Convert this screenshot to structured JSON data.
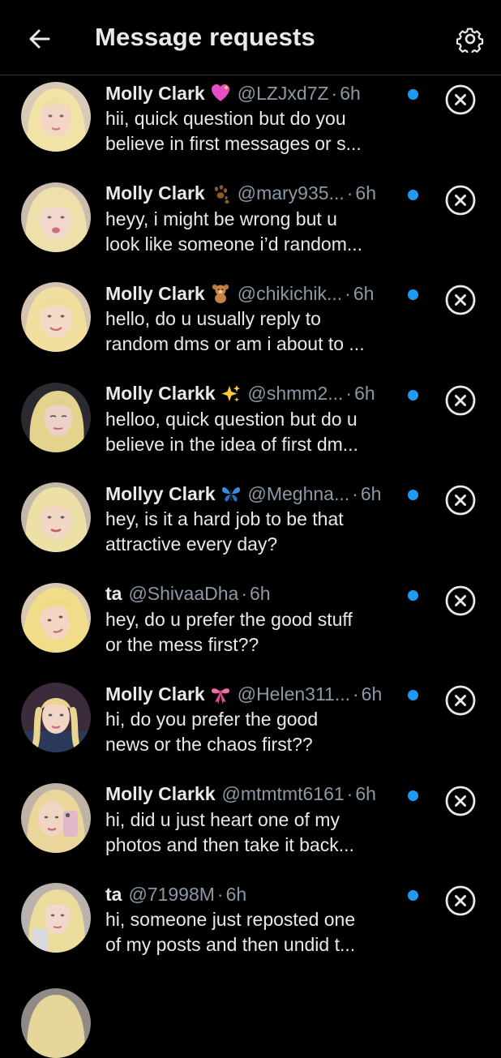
{
  "header": {
    "title": "Message requests",
    "back_icon": "arrow-left-icon",
    "settings_icon": "gear-icon"
  },
  "colors": {
    "background": "#000000",
    "text_primary": "#e7e9ea",
    "text_secondary": "#8b98a5",
    "unread_dot": "#1d9bf0"
  },
  "requests": [
    {
      "name": "Molly Clark",
      "emoji_icon": "sparkling-heart-icon",
      "handle": "@LZJxd7Z",
      "time": "6h",
      "line1": "hii, quick question but do you",
      "line2": "believe in first messages or s...",
      "unread": true
    },
    {
      "name": "Molly Clark",
      "emoji_icon": "paw-prints-icon",
      "handle": "@mary935...",
      "time": "6h",
      "line1": "heyy, i might be wrong but u",
      "line2": "look like someone i’d random...",
      "unread": true
    },
    {
      "name": "Molly Clark",
      "emoji_icon": "teddy-bear-icon",
      "handle": "@chikichik...",
      "time": "6h",
      "line1": "hello, do u usually reply to",
      "line2": "random dms or am i about to ...",
      "unread": true
    },
    {
      "name": "Molly Clarkk",
      "emoji_icon": "sparkles-icon",
      "handle": "@shmm2...",
      "time": "6h",
      "line1": "helloo, quick question but do u",
      "line2": "believe in the idea of first dm...",
      "unread": true
    },
    {
      "name": "Mollyy Clark",
      "emoji_icon": "butterfly-icon",
      "handle": "@Meghna...",
      "time": "6h",
      "line1": "hey, is it a hard job to be that",
      "line2": "attractive every day?",
      "unread": true
    },
    {
      "name": "ta",
      "emoji_icon": "",
      "handle": "@ShivaaDha",
      "time": "6h",
      "line1": "hey, do u prefer the good stuff",
      "line2": "or the mess first??",
      "unread": true
    },
    {
      "name": "Molly Clark",
      "emoji_icon": "ribbon-icon",
      "handle": "@Helen311...",
      "time": "6h",
      "line1": "hi, do you prefer the good",
      "line2": "news or the chaos first??",
      "unread": true
    },
    {
      "name": "Molly Clarkk",
      "emoji_icon": "",
      "handle": "@mtmtmt6161",
      "time": "6h",
      "line1": "hi, did u just heart one of my",
      "line2": "photos and then take it back...",
      "unread": true
    },
    {
      "name": "ta",
      "emoji_icon": "",
      "handle": "@71998M",
      "time": "6h",
      "line1": "hi, someone just reposted one",
      "line2": "of my posts and then undid t...",
      "unread": true
    }
  ],
  "dismiss_icon": "close-circle-icon"
}
